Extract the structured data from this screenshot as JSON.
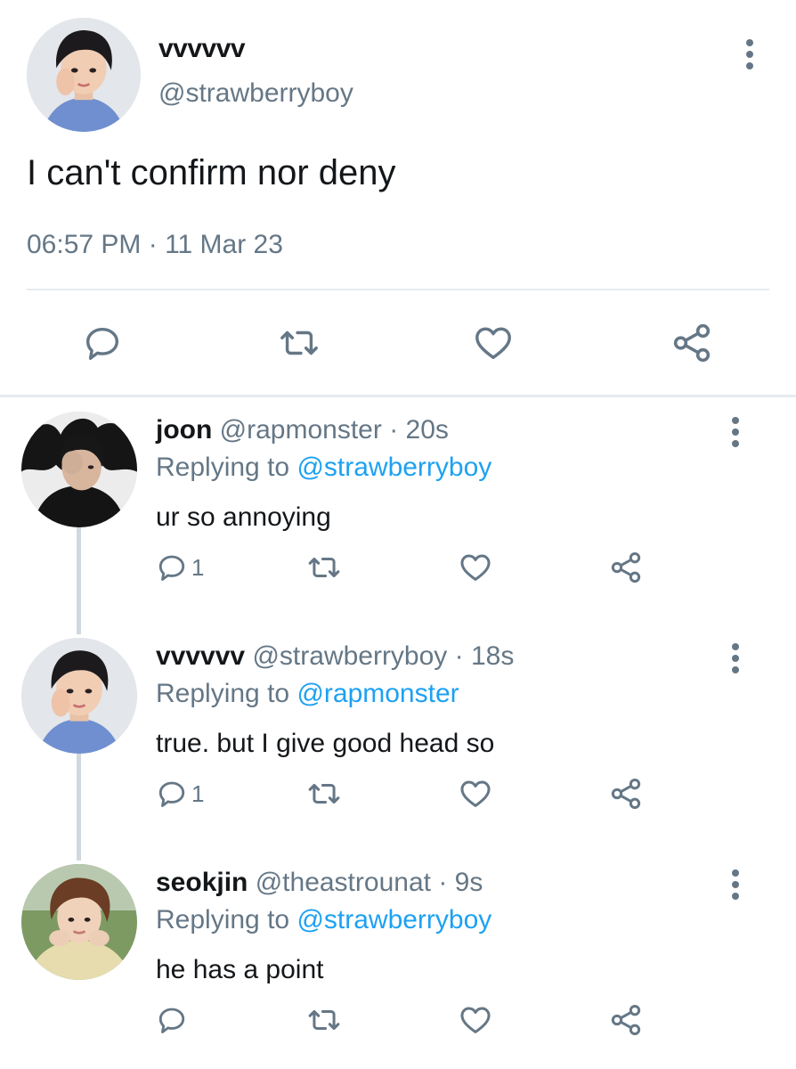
{
  "main_tweet": {
    "display_name": "vvvvvv",
    "handle": "@strawberryboy",
    "text": "I can't confirm nor deny",
    "timestamp": "06:57 PM · 11 Mar 23",
    "icons": {
      "more": "more-vertical-icon",
      "reply": "reply-icon",
      "retweet": "retweet-icon",
      "like": "heart-icon",
      "share": "share-icon"
    }
  },
  "replies": [
    {
      "display_name": "joon",
      "handle": "@rapmonster",
      "age": "20s",
      "replying_label": "Replying to",
      "replying_to": "@strawberryboy",
      "text": "ur so annoying",
      "reply_count": "1"
    },
    {
      "display_name": "vvvvvv",
      "handle": "@strawberryboy",
      "age": "18s",
      "replying_label": "Replying to",
      "replying_to": "@rapmonster",
      "text": "true. but I give good head so",
      "reply_count": "1"
    },
    {
      "display_name": "seokjin",
      "handle": "@theastrounat",
      "age": "9s",
      "replying_label": "Replying to",
      "replying_to": "@strawberryboy",
      "text": "he has a point",
      "reply_count": ""
    }
  ],
  "colors": {
    "text_primary": "#14171a",
    "text_secondary": "#657786",
    "link": "#1da1f2",
    "divider": "#e6ecf0",
    "thread_line": "#cfd9de"
  }
}
